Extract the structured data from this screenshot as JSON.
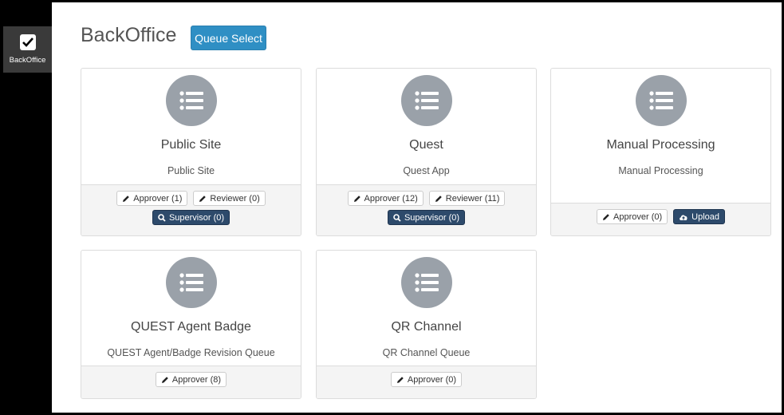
{
  "sidebar": {
    "items": [
      {
        "label": "BackOffice",
        "icon": "checkbox-icon"
      }
    ]
  },
  "header": {
    "title": "BackOffice",
    "queue_select_label": "Queue Select"
  },
  "colors": {
    "accent": "#2f8fc4",
    "dark_button": "#2d4a6b",
    "avatar": "#9aa1a9",
    "sidebar": "#000000"
  },
  "cards": [
    {
      "title": "Public Site",
      "subtitle": "Public Site",
      "approver": "Approver (1)",
      "reviewer": "Reviewer (0)",
      "supervisor": "Supervisor (0)"
    },
    {
      "title": "Quest",
      "subtitle": "Quest App",
      "approver": "Approver (12)",
      "reviewer": "Reviewer (11)",
      "supervisor": "Supervisor (0)"
    },
    {
      "title": "Manual Processing",
      "subtitle": "Manual Processing",
      "approver": "Approver (0)",
      "upload": "Upload"
    },
    {
      "title": "QUEST Agent Badge",
      "subtitle": "QUEST Agent/Badge Revision Queue",
      "approver": "Approver (8)"
    },
    {
      "title": "QR Channel",
      "subtitle": "QR Channel Queue",
      "approver": "Approver (0)"
    }
  ]
}
